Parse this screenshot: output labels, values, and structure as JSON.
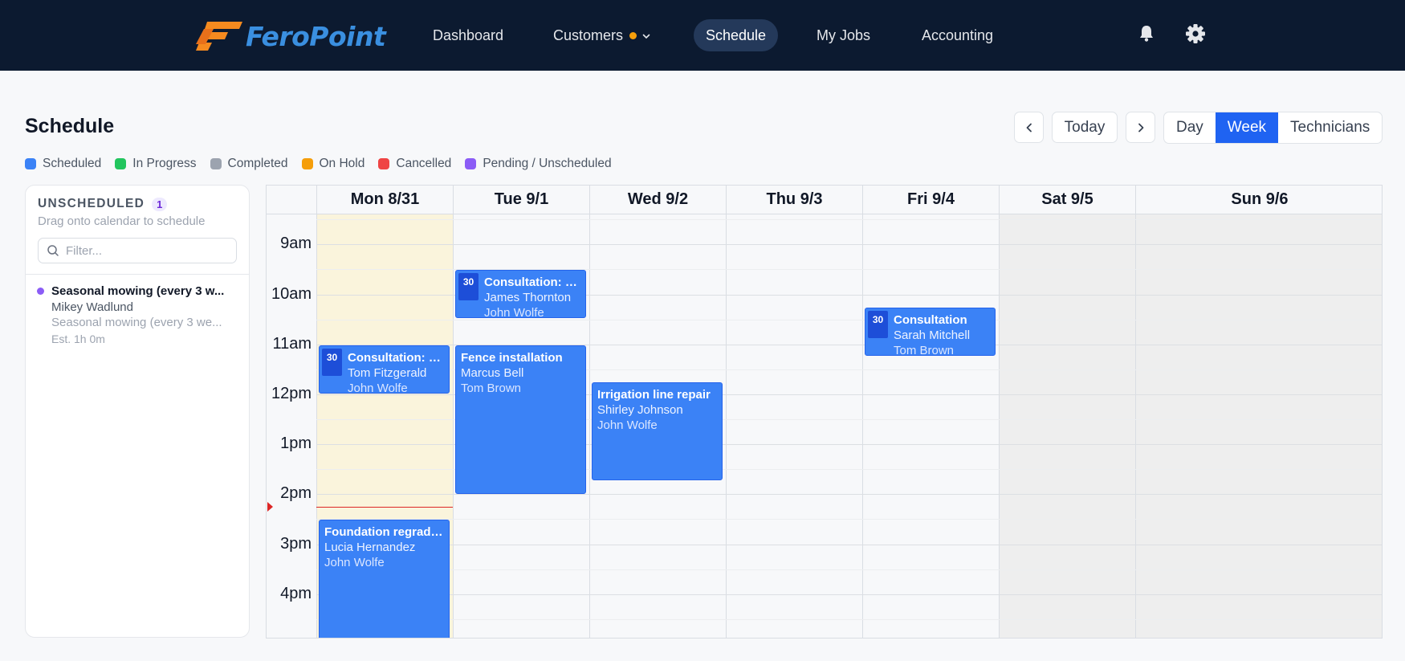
{
  "nav": {
    "brand": "FeroPoint",
    "items": [
      {
        "label": "Dashboard"
      },
      {
        "label": "Customers"
      },
      {
        "label": "Schedule"
      },
      {
        "label": "My Jobs"
      },
      {
        "label": "Accounting"
      }
    ],
    "active": "Schedule",
    "customers_has_indicator": true,
    "icons": [
      "bell-icon",
      "gear-icon"
    ]
  },
  "header": {
    "title": "Schedule",
    "today_label": "Today",
    "views": [
      {
        "label": "Day"
      },
      {
        "label": "Week"
      },
      {
        "label": "Technicians"
      }
    ],
    "active_view": "Week"
  },
  "legend": [
    {
      "label": "Scheduled",
      "color": "#3b82f6"
    },
    {
      "label": "In Progress",
      "color": "#22c55e"
    },
    {
      "label": "Completed",
      "color": "#9ca3af"
    },
    {
      "label": "On Hold",
      "color": "#f59e0b"
    },
    {
      "label": "Cancelled",
      "color": "#ef4444"
    },
    {
      "label": "Pending / Unscheduled",
      "color": "#8b5cf6"
    }
  ],
  "unscheduled": {
    "heading": "UNSCHEDULED",
    "count": "1",
    "subtitle": "Drag onto calendar to schedule",
    "filter_placeholder": "Filter...",
    "items": [
      {
        "title": "Seasonal mowing (every 3 w...",
        "customer": "Mikey Wadlund",
        "description": "Seasonal mowing (every 3 we...",
        "estimate": "Est. 1h 0m"
      }
    ]
  },
  "calendar": {
    "days": [
      {
        "label": "Mon 8/31",
        "today": true,
        "weekend": false
      },
      {
        "label": "Tue 9/1",
        "today": false,
        "weekend": false
      },
      {
        "label": "Wed 9/2",
        "today": false,
        "weekend": false
      },
      {
        "label": "Thu 9/3",
        "today": false,
        "weekend": false
      },
      {
        "label": "Fri 9/4",
        "today": false,
        "weekend": false
      },
      {
        "label": "Sat 9/5",
        "today": false,
        "weekend": true
      },
      {
        "label": "Sun 9/6",
        "today": false,
        "weekend": true
      }
    ],
    "hours": [
      "9am",
      "10am",
      "11am",
      "12pm",
      "1pm",
      "2pm",
      "3pm",
      "4pm"
    ],
    "first_hour": 9,
    "visible_start_hour": 8.4,
    "now_hour": 14.25,
    "now_day": 0,
    "events": [
      {
        "day": 1,
        "start": 9.5,
        "end": 10.5,
        "title": "Consultation: Dri...",
        "customer": "James Thornton",
        "tech": "John Wolfe",
        "badge": "30"
      },
      {
        "day": 0,
        "start": 11.0,
        "end": 12.0,
        "title": "Consultation: W...",
        "customer": "Tom Fitzgerald",
        "tech": "John Wolfe",
        "badge": "30"
      },
      {
        "day": 1,
        "start": 11.0,
        "end": 14.0,
        "title": "Fence installation",
        "customer": "Marcus Bell",
        "tech": "Tom Brown",
        "badge": ""
      },
      {
        "day": 2,
        "start": 11.75,
        "end": 13.75,
        "title": "Irrigation line repair",
        "customer": "Shirley Johnson",
        "tech": "John Wolfe",
        "badge": ""
      },
      {
        "day": 4,
        "start": 10.25,
        "end": 11.25,
        "title": "Consultation",
        "customer": "Sarah Mitchell",
        "tech": "Tom Brown",
        "badge": "30"
      },
      {
        "day": 0,
        "start": 14.5,
        "end": 17.5,
        "title": "Foundation regrading",
        "customer": "Lucia Hernandez",
        "tech": "John Wolfe",
        "badge": ""
      }
    ]
  }
}
